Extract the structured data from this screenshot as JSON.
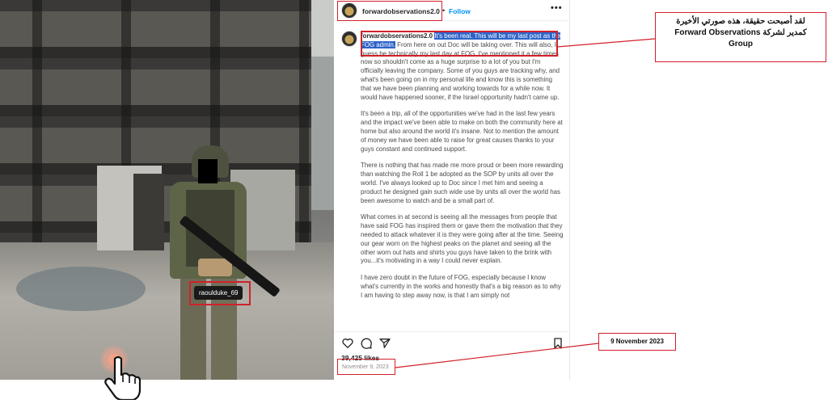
{
  "post": {
    "username": "forwardobservations2.0",
    "separator": "•",
    "follow_label": "Follow",
    "more_label": "•••",
    "caption": {
      "username": "forwardobservations2.0",
      "highlighted": "It's been real. This will be my last post as the FOG admin.",
      "p1_rest": " From here on out Doc will be taking over. This will also, I guess be technically my last day at FOG. I've mentioned it a few times now so shouldn't come as a huge surprise to a lot of you but I'm officially leaving the company. Some of you guys are tracking why, and what's been going on in my personal life and know this is something that we have been planning and working towards for a while now. It would have happened sooner, if the Israel opportunity hadn't came up.",
      "p2": "It's been a trip, all of the opportunities we've had in the last few years and the impact we've been able to make on both the community here at home but also around the world it's insane. Not to mention the amount of money we have been able to raise for great causes thanks to your guys constant and continued support.",
      "p3": "There is nothing that has made me more proud or been more rewarding than watching the Roll 1 be adopted as the SOP by units all over the world. I've always looked up to Doc since I met him and seeing a product he designed gain such wide use by units all over the world has been awesome to watch and be a small part of.",
      "p4": "What comes in at second is seeing all the messages from people that have said FOG has inspired them or gave them the motivation that they needed to attack whatever it is they were going after at the time. Seeing our gear worn on the highest peaks on the planet and seeing all the other worn out hats and shirts you guys have taken to the brink with you...it's motivating in a way I could never explain.",
      "p5": "I have zero doubt in the future of FOG, especially because I know what's currently in the works and honestly that's a big reason as to why I am having to step away now, is that I am simply not"
    },
    "likes": "39,425 likes",
    "date": "November 9, 2023"
  },
  "photo": {
    "tag": "raoulduke_69"
  },
  "annotations": {
    "arabic_line1": "لقد أصبحت حقيقة، هذه صورتي الأخيرة",
    "arabic_line2": "كمدير لشركة  Forward Observations",
    "arabic_line3": "Group",
    "date_label": "9 November 2023"
  },
  "icons": [
    "heart-icon",
    "comment-icon",
    "share-icon",
    "bookmark-icon",
    "hand-pointer-icon"
  ],
  "colors": {
    "follow": "#0095f6",
    "highlight": "#2d63c8",
    "annotation_red": "#d2202a"
  }
}
